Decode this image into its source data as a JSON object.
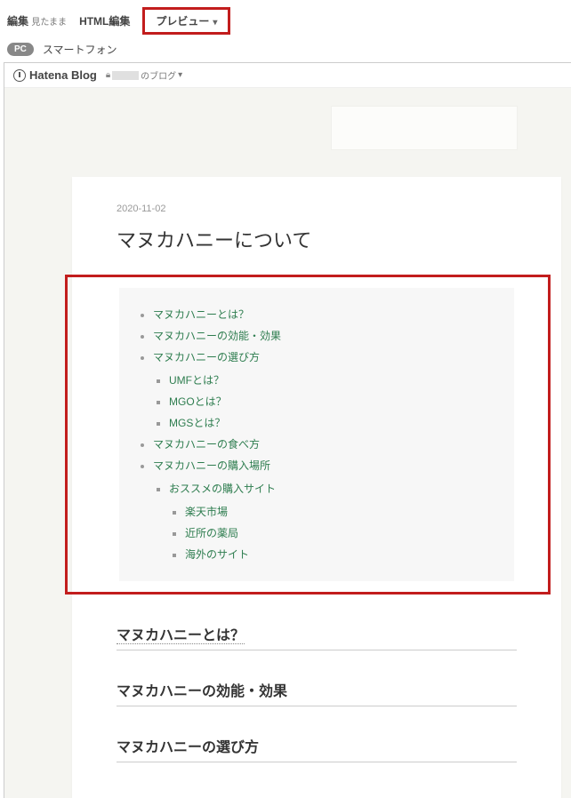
{
  "tabs": {
    "edit": "編集",
    "edit_sub": "見たまま",
    "html": "HTML編集",
    "preview": "プレビュー"
  },
  "subtabs": {
    "pc": "PC",
    "smartphone": "スマートフォン"
  },
  "brand": "Hatena Blog",
  "blog_suffix": "のブログ",
  "post": {
    "date": "2020-11-02",
    "title": "マヌカハニーについて"
  },
  "toc": [
    {
      "label": "マヌカハニーとは？"
    },
    {
      "label": "マヌカハニーの効能・効果"
    },
    {
      "label": "マヌカハニーの選び方",
      "children": [
        {
          "label": "UMFとは？"
        },
        {
          "label": "MGOとは？"
        },
        {
          "label": "MGSとは？"
        }
      ]
    },
    {
      "label": "マヌカハニーの食べ方"
    },
    {
      "label": "マヌカハニーの購入場所",
      "children": [
        {
          "label": "おススメの購入サイト",
          "children": [
            {
              "label": "楽天市場"
            },
            {
              "label": "近所の薬局"
            },
            {
              "label": "海外のサイト"
            }
          ]
        }
      ]
    }
  ],
  "headings": {
    "h1": "マヌカハニーとは？",
    "h2": "マヌカハニーの効能・効果",
    "h3": "マヌカハニーの選び方"
  }
}
